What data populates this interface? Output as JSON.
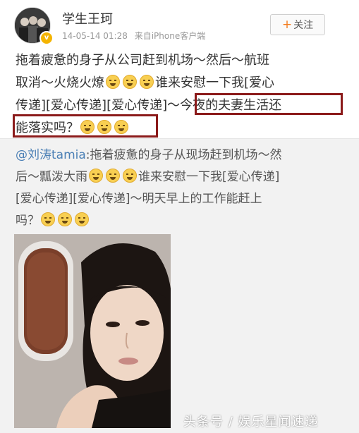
{
  "user": {
    "name": "学生王珂",
    "timestamp": "14-05-14 01:28",
    "source": "来自iPhone客户端"
  },
  "follow": {
    "plus": "+",
    "label": "关注"
  },
  "post": {
    "lines": [
      "拖着疲惫的身子从公司赶到机场～然后～航班",
      "取消～火烧火燎",
      "谁来安慰一下我[爱心",
      "传递][爱心传递][爱心传递]～",
      "今夜的夫妻生活还",
      "能落实吗？"
    ]
  },
  "repost": {
    "mention": "@刘涛tamia",
    "lines": [
      ":拖着疲惫的身子从现场赶到机场～然",
      "后～瓢泼大雨",
      "谁来安慰一下我[爱心传递]",
      "[爱心传递][爱心传递]～明天早上的工作能赶上",
      "吗？"
    ]
  },
  "emoji_name": "crying-face-icon",
  "highlight_color": "#8b1a1a",
  "watermark": "头条号 / 娱乐星闻速递"
}
